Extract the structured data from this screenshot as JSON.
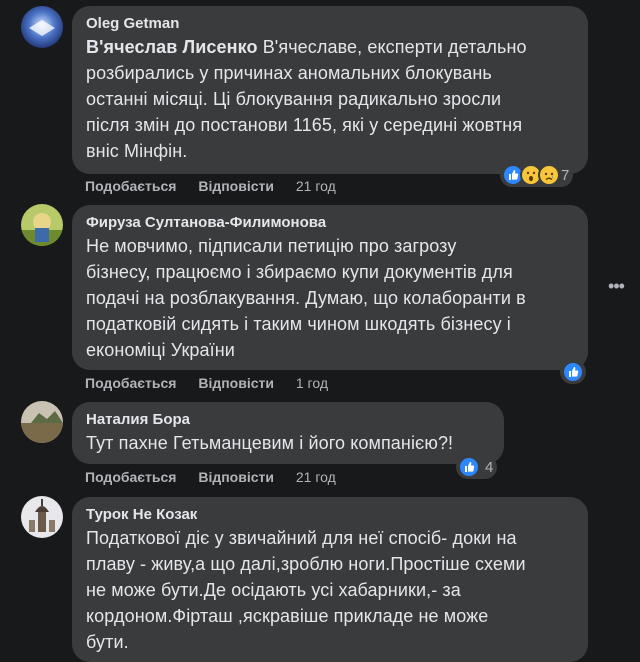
{
  "comments": [
    {
      "author": "Oleg Getman",
      "mention": "В'ячеслав Лисенко",
      "lines": [
        "В'ячеславе, експерти детально",
        "розбирались у причинах аномальних блокувань",
        "останні місяці. Ці блокування радикально зросли",
        "після змін до постанови 1165, які у середині жовтня",
        "вніс Мінфін."
      ],
      "like": "Подобається",
      "reply": "Відповісти",
      "time": "21 год",
      "reaction_count": "7"
    },
    {
      "author": "Фируза Султанова-Филимонова",
      "lines": [
        "Не мовчимо, підписали петицію про загрозу",
        "бізнесу, працюємо і збираємо купи документів для",
        "подачі на розблакування. Думаю, що колаборанти в",
        "податковій сидять і таким чином шкодять бізнесу і",
        "економіці України"
      ],
      "like": "Подобається",
      "reply": "Відповісти",
      "time": "1 год"
    },
    {
      "author": "Наталия Бора",
      "lines": [
        "Тут пахне Гетьманцевим і його компанією?!"
      ],
      "like": "Подобається",
      "reply": "Відповісти",
      "time": "21 год",
      "reaction_count": "4"
    },
    {
      "author": "Турок Не Козак",
      "lines": [
        "Податкової діє у звичайний для неї спосіб- доки на",
        "плаву - живу,а що далі,зроблю ноги.Простіше схеми",
        "не може бути.Де осідають усі хабарники,- за",
        "кордоном.Фірташ ,яскравіше прикладе не може",
        "бути."
      ]
    }
  ],
  "colors": {
    "bg": "#18191a",
    "bubble": "#3a3b3c",
    "text": "#e4e6eb",
    "muted": "#b0b3b8",
    "like": "#2d88ff"
  },
  "icons": [
    "like-icon",
    "wow-icon",
    "sad-icon",
    "more-options-icon"
  ]
}
